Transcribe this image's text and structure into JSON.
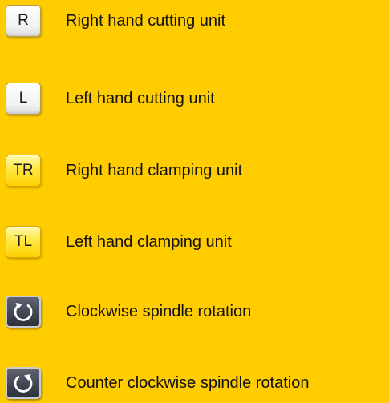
{
  "colors": {
    "background": "#ffcc00",
    "text": "#111111"
  },
  "legend": {
    "items": [
      {
        "key_label": "R",
        "key_style": "white",
        "description": "Right hand cutting unit"
      },
      {
        "key_label": "L",
        "key_style": "white",
        "description": "Left hand cutting unit"
      },
      {
        "key_label": "TR",
        "key_style": "yellow",
        "description": "Right hand clamping unit"
      },
      {
        "key_label": "TL",
        "key_style": "yellow",
        "description": "Left hand clamping unit"
      },
      {
        "key_icon": "clockwise-rotation-icon",
        "key_style": "dark",
        "description": "Clockwise spindle rotation"
      },
      {
        "key_icon": "counter-clockwise-rotation-icon",
        "key_style": "dark",
        "description": "Counter clockwise spindle rotation"
      }
    ]
  }
}
